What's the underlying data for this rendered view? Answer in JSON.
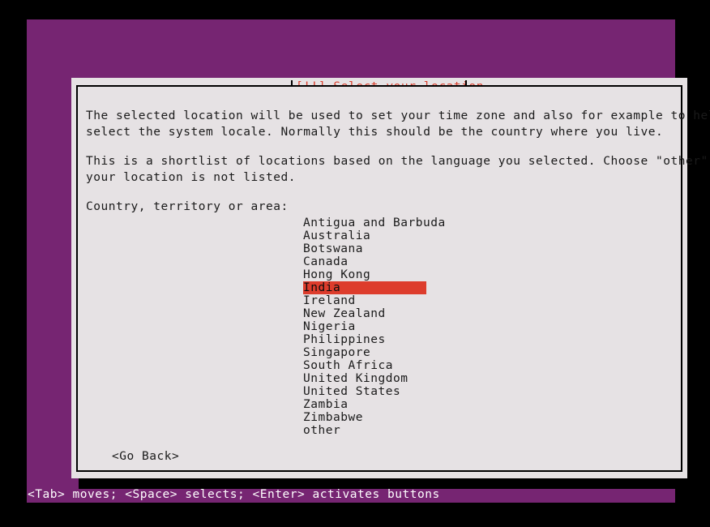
{
  "colors": {
    "terminal_bg": "#762572",
    "dialog_bg": "#e6e2e4",
    "title_red": "#d93f2d",
    "highlight_red": "#dd3c2c",
    "text": "#1a1a1a",
    "status_text": "#ffffff",
    "page_bg": "#000000"
  },
  "dialog": {
    "title": "[!!] Select your location",
    "paragraph1": [
      "The selected location will be used to set your time zone and also for example to help",
      "select the system locale. Normally this should be the country where you live."
    ],
    "paragraph2": [
      "This is a shortlist of locations based on the language you selected. Choose \"other\" if",
      "your location is not listed."
    ],
    "list_label": "Country, territory or area:",
    "go_back_label": "<Go Back>"
  },
  "country_list": {
    "selected_index": 5,
    "items": [
      {
        "label": "Antigua and Barbuda",
        "selected": false
      },
      {
        "label": "Australia",
        "selected": false
      },
      {
        "label": "Botswana",
        "selected": false
      },
      {
        "label": "Canada",
        "selected": false
      },
      {
        "label": "Hong Kong",
        "selected": false
      },
      {
        "label": "India",
        "selected": true
      },
      {
        "label": "Ireland",
        "selected": false
      },
      {
        "label": "New Zealand",
        "selected": false
      },
      {
        "label": "Nigeria",
        "selected": false
      },
      {
        "label": "Philippines",
        "selected": false
      },
      {
        "label": "Singapore",
        "selected": false
      },
      {
        "label": "South Africa",
        "selected": false
      },
      {
        "label": "United Kingdom",
        "selected": false
      },
      {
        "label": "United States",
        "selected": false
      },
      {
        "label": "Zambia",
        "selected": false
      },
      {
        "label": "Zimbabwe",
        "selected": false
      },
      {
        "label": "other",
        "selected": false
      }
    ]
  },
  "status_bar": {
    "text": "<Tab> moves; <Space> selects; <Enter> activates buttons"
  }
}
